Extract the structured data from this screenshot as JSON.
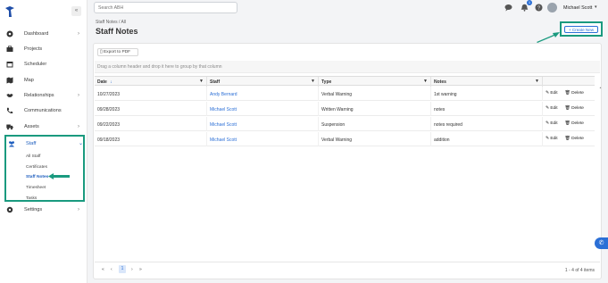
{
  "sidebar": {
    "items": [
      {
        "label": "Dashboard",
        "icon": "dashboard-icon",
        "chevron": true
      },
      {
        "label": "Projects",
        "icon": "briefcase-icon",
        "chevron": false
      },
      {
        "label": "Scheduler",
        "icon": "calendar-icon",
        "chevron": false
      },
      {
        "label": "Map",
        "icon": "map-icon",
        "chevron": false
      },
      {
        "label": "Relationships",
        "icon": "handshake-icon",
        "chevron": true
      },
      {
        "label": "Communications",
        "icon": "phone-icon",
        "chevron": false
      },
      {
        "label": "Assets",
        "icon": "truck-icon",
        "chevron": true
      },
      {
        "label": "Staff",
        "icon": "users-icon",
        "chevron": true
      },
      {
        "label": "Settings",
        "icon": "gear-icon",
        "chevron": true
      }
    ],
    "staff_sub": [
      "All Staff",
      "Certificates",
      "Staff Notes",
      "Timesheet",
      "Tasks"
    ]
  },
  "search": {
    "placeholder": "Search ABH"
  },
  "header": {
    "notification_count": "1",
    "user_name": "Michael Scott"
  },
  "page": {
    "breadcrumb": "Staff Notes / All",
    "title": "Staff Notes",
    "create_label": "+ Create New",
    "export_label": "Export to PDF",
    "group_hint": "Drag a column header and drop it here to group by that column"
  },
  "table": {
    "columns": [
      "Date",
      "Staff",
      "Type",
      "Notes"
    ],
    "rows": [
      {
        "date": "10/27/2023",
        "staff": "Andy Bernard",
        "type": "Verbal Warning",
        "notes": "1st warning"
      },
      {
        "date": "09/28/2023",
        "staff": "Michael Scott",
        "type": "Written Warning",
        "notes": "notes"
      },
      {
        "date": "09/22/2023",
        "staff": "Michael Scott",
        "type": "Suspension",
        "notes": "notes required"
      },
      {
        "date": "09/18/2023",
        "staff": "Michael Scott",
        "type": "Verbal Warning",
        "notes": "addition"
      }
    ],
    "edit_label": "Edit",
    "delete_label": "Delete"
  },
  "pager": {
    "current": "1",
    "info": "1 - 4 of 4 items"
  },
  "colors": {
    "accent": "#1a9a7f",
    "brand_blue": "#2b6fd6"
  }
}
